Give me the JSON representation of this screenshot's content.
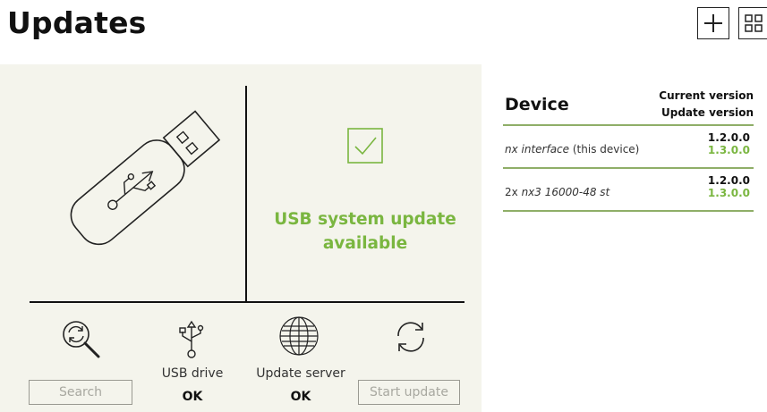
{
  "page": {
    "title": "Updates",
    "add_icon": "plus-icon",
    "layout_icon": "grid-icon"
  },
  "usb_panel": {
    "icon": "usb-stick-icon",
    "status_icon": "checkbox-checked-icon",
    "status_text": "USB system update available",
    "accent_color": "#7ab640"
  },
  "tools": {
    "search": {
      "icon": "magnifier-refresh-icon",
      "button_label": "Search"
    },
    "usb": {
      "icon": "usb-icon",
      "label": "USB drive",
      "status": "OK"
    },
    "server": {
      "icon": "globe-icon",
      "label": "Update server",
      "status": "OK"
    },
    "start": {
      "icon": "refresh-icon",
      "button_label": "Start update"
    }
  },
  "table": {
    "header_device": "Device",
    "header_current": "Current version",
    "header_update": "Update version",
    "rows": [
      {
        "prefix": "",
        "name": "nx interface",
        "suffix": " (this device)",
        "current": "1.2.0.0",
        "update": "1.3.0.0"
      },
      {
        "prefix": "2x ",
        "name": "nx3 16000-48 st",
        "suffix": "",
        "current": "1.2.0.0",
        "update": "1.3.0.0"
      }
    ]
  }
}
